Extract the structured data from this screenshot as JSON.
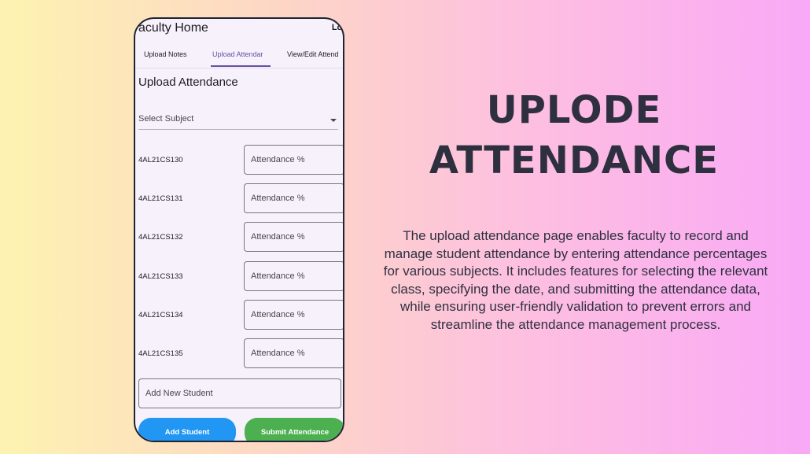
{
  "phone": {
    "appbar": {
      "title": "aculty Home",
      "logout": "Log"
    },
    "tabs": [
      {
        "label": "Upload Notes",
        "active": false
      },
      {
        "label": "Upload Attendar",
        "active": true
      },
      {
        "label": "View/Edit Attend",
        "active": false
      }
    ],
    "section_title": "Upload Attendance",
    "subject_dropdown": {
      "label": "Select Subject"
    },
    "students": [
      {
        "id": "4AL21CS130",
        "placeholder": "Attendance %"
      },
      {
        "id": "4AL21CS131",
        "placeholder": "Attendance %"
      },
      {
        "id": "4AL21CS132",
        "placeholder": "Attendance %"
      },
      {
        "id": "4AL21CS133",
        "placeholder": "Attendance %"
      },
      {
        "id": "4AL21CS134",
        "placeholder": "Attendance %"
      },
      {
        "id": "4AL21CS135",
        "placeholder": "Attendance %"
      }
    ],
    "new_student_placeholder": "Add New Student",
    "buttons": {
      "add": "Add Student",
      "submit": "Submit Attendance"
    },
    "colors": {
      "accent": "#6750a4",
      "add_button": "#2196f3",
      "submit_button": "#4caf50"
    }
  },
  "headline": {
    "line1": "UPLODE",
    "line2": "ATTENDANCE"
  },
  "description": "The upload attendance page enables faculty to record and manage student attendance by entering attendance percentages for various subjects. It includes features for selecting the relevant class, specifying the date, and submitting the attendance data, while ensuring user-friendly validation to prevent errors and streamline the attendance management process."
}
